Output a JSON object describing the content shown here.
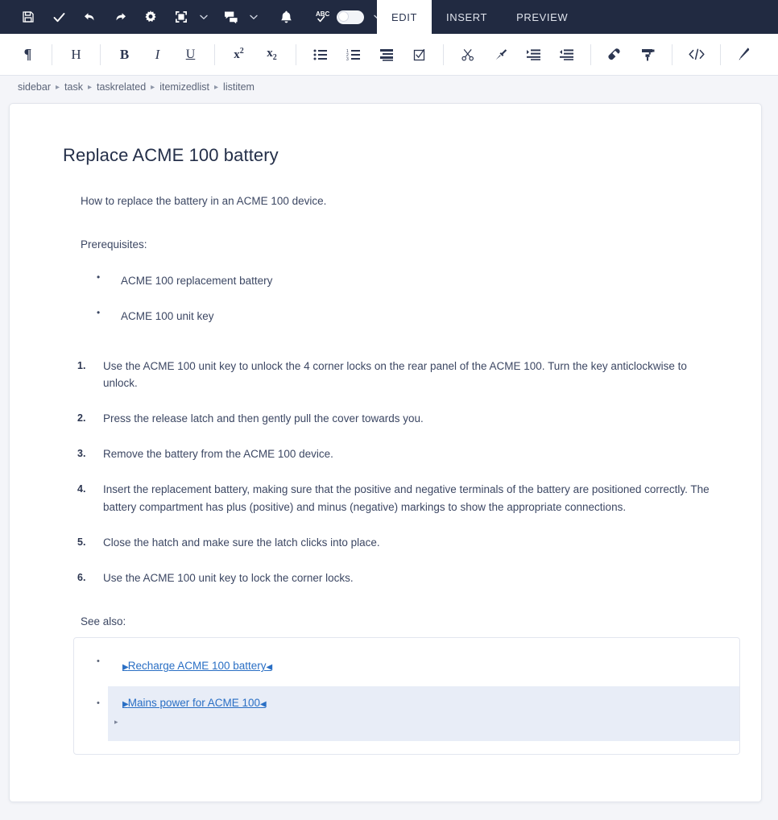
{
  "topbar": {
    "buttons": [
      {
        "name": "save-icon",
        "label": "Save"
      },
      {
        "name": "check-icon",
        "label": "Validate"
      },
      {
        "name": "undo-icon",
        "label": "Undo"
      },
      {
        "name": "redo-icon",
        "label": "Redo"
      },
      {
        "name": "gear-icon",
        "label": "Settings"
      },
      {
        "name": "fullscreen-icon",
        "label": "Fullscreen"
      },
      {
        "name": "comment-icon",
        "label": "Comments"
      },
      {
        "name": "bell-icon",
        "label": "Notifications"
      },
      {
        "name": "spellcheck-icon",
        "label": "Spell check"
      }
    ],
    "spellcheck_toggle_state": "off"
  },
  "tabs": [
    {
      "label": "EDIT",
      "active": true
    },
    {
      "label": "INSERT",
      "active": false
    },
    {
      "label": "PREVIEW",
      "active": false
    }
  ],
  "formatbar": [
    {
      "name": "paragraph-mark-icon",
      "glyph": "¶"
    },
    {
      "sep": true
    },
    {
      "name": "heading-icon",
      "glyph": "H"
    },
    {
      "sep": true
    },
    {
      "name": "bold-icon",
      "glyph": "B"
    },
    {
      "name": "italic-icon",
      "glyph": "I"
    },
    {
      "name": "underline-icon",
      "glyph": "U"
    },
    {
      "sep": true
    },
    {
      "name": "superscript-icon",
      "glyph": "x²"
    },
    {
      "name": "subscript-icon",
      "glyph": "x₂"
    },
    {
      "sep": true
    },
    {
      "name": "bullet-list-icon",
      "glyph": "list"
    },
    {
      "name": "numbered-list-icon",
      "glyph": "numlist"
    },
    {
      "name": "definition-list-icon",
      "glyph": "deflist"
    },
    {
      "name": "task-list-icon",
      "glyph": "checkbox"
    },
    {
      "sep": true
    },
    {
      "name": "cut-icon",
      "glyph": "scissors"
    },
    {
      "name": "paste-icon",
      "glyph": "pin"
    },
    {
      "name": "indent-icon",
      "glyph": "indent"
    },
    {
      "name": "outdent-icon",
      "glyph": "outdent"
    },
    {
      "sep": true
    },
    {
      "name": "eraser-icon",
      "glyph": "eraser"
    },
    {
      "name": "format-painter-icon",
      "glyph": "roller"
    },
    {
      "sep": true
    },
    {
      "name": "source-code-icon",
      "glyph": "</>"
    },
    {
      "sep": true
    },
    {
      "name": "edit-pencil-icon",
      "glyph": "pencil"
    }
  ],
  "breadcrumb": {
    "separator": "▸",
    "items": [
      "sidebar",
      "task",
      "taskrelated",
      "itemizedlist",
      "listitem"
    ]
  },
  "document": {
    "title": "Replace ACME 100 battery",
    "intro": "How to replace the battery in an ACME 100 device.",
    "prerequisites_label": "Prerequisites:",
    "prerequisites": [
      "ACME 100 replacement battery",
      "ACME 100 unit key"
    ],
    "steps": [
      "Use the ACME 100 unit key to unlock the 4 corner locks on the rear panel of the ACME 100. Turn the key anticlockwise to unlock.",
      "Press the release latch and then gently pull the cover towards you.",
      "Remove the battery from the ACME 100 device.",
      "Insert the replacement battery, making sure that the positive and negative terminals of the battery are positioned correctly. The battery compartment has plus (positive) and minus (negative) markings to show the appropriate connections.",
      "Close the hatch and make sure the latch clicks into place.",
      "Use the ACME 100 unit key to lock the corner locks."
    ],
    "see_also_label": "See also:",
    "see_also": [
      {
        "text": "Recharge ACME 100 battery",
        "selected": false
      },
      {
        "text": "Mains power for ACME 100",
        "selected": true
      }
    ],
    "xref_start_mark": "▶",
    "xref_end_mark": "◀",
    "tag_caret_mark": "▸"
  },
  "colors": {
    "topbar_bg": "#212a41",
    "accent_link": "#2a6fc4",
    "selection_bg": "#e8edf7",
    "page_bg": "#f4f5f9",
    "text": "#3c4763"
  }
}
